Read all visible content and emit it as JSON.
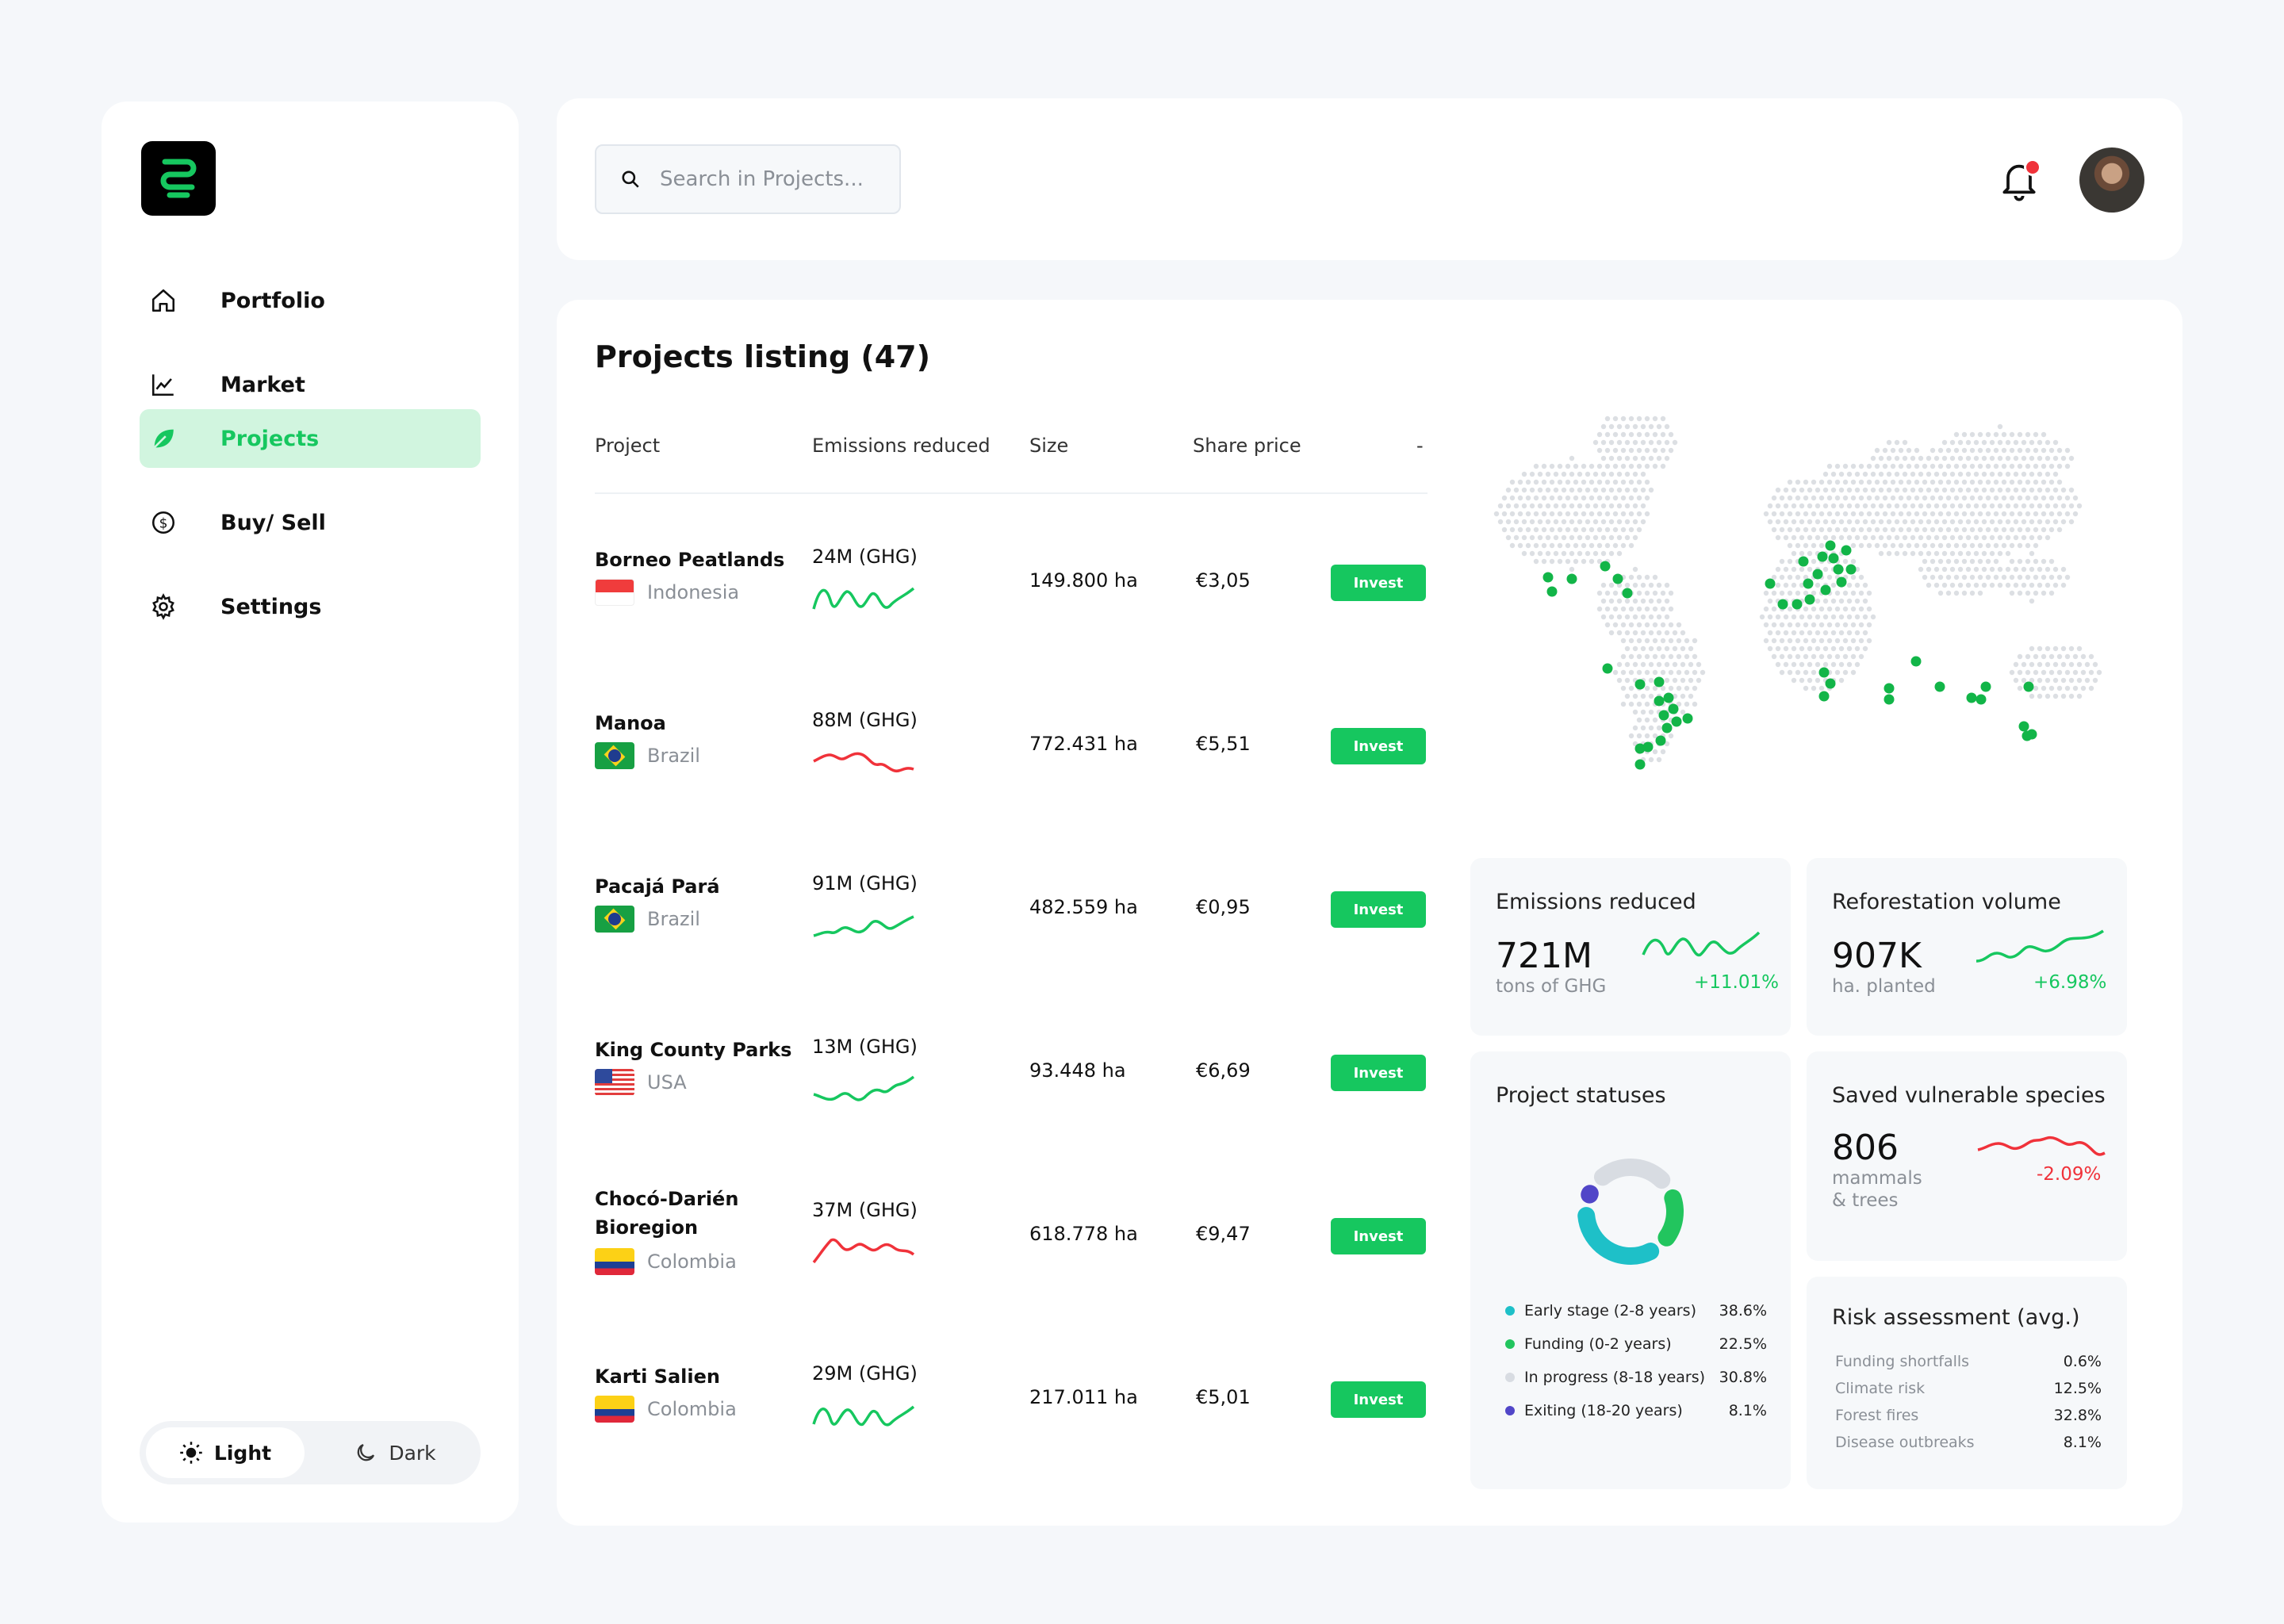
{
  "sidebar": {
    "nav": [
      {
        "label": "Portfolio",
        "icon": "home-icon"
      },
      {
        "label": "Market",
        "icon": "chart-icon"
      },
      {
        "label": "Projects",
        "icon": "leaf-icon",
        "active": true
      },
      {
        "label": "Buy/ Sell",
        "icon": "dollar-icon"
      },
      {
        "label": "Settings",
        "icon": "gear-icon"
      }
    ],
    "theme": {
      "light": "Light",
      "dark": "Dark",
      "selected": "Light"
    }
  },
  "topbar": {
    "search_placeholder": "Search in Projects...",
    "has_notification": true
  },
  "projects": {
    "title": "Projects listing (47)",
    "columns": [
      "Project",
      "Emissions reduced",
      "Size",
      "Share price",
      "-"
    ],
    "rows": [
      {
        "name": "Borneo Peatlands",
        "country": "Indonesia",
        "emissions": "24M (GHG)",
        "size": "149.800 ha",
        "price": "€3,05",
        "action": "Invest",
        "trend": "up"
      },
      {
        "name": "Manoa",
        "country": "Brazil",
        "emissions": "88M (GHG)",
        "size": "772.431 ha",
        "price": "€5,51",
        "action": "Invest",
        "trend": "down"
      },
      {
        "name": "Pacajá Pará",
        "country": "Brazil",
        "emissions": "91M (GHG)",
        "size": "482.559 ha",
        "price": "€0,95",
        "action": "Invest",
        "trend": "up"
      },
      {
        "name": "King County Parks",
        "country": "USA",
        "emissions": "13M (GHG)",
        "size": "93.448 ha",
        "price": "€6,69",
        "action": "Invest",
        "trend": "up"
      },
      {
        "name": "Chocó-Darién Bioregion",
        "country": "Colombia",
        "emissions": "37M (GHG)",
        "size": "618.778 ha",
        "price": "€9,47",
        "action": "Invest",
        "trend": "down"
      },
      {
        "name": "Karti Salien",
        "country": "Colombia",
        "emissions": "29M (GHG)",
        "size": "217.011 ha",
        "price": "€5,01",
        "action": "Invest",
        "trend": "up"
      }
    ]
  },
  "stats": {
    "emissions": {
      "title": "Emissions reduced",
      "value": "721M",
      "unit": "tons of GHG",
      "change": "+11.01%"
    },
    "reforestation": {
      "title": "Reforestation volume",
      "value": "907K",
      "unit": "ha. planted",
      "change": "+6.98%"
    },
    "species": {
      "title": "Saved vulnerable species",
      "value": "806",
      "unit1": "mammals",
      "unit2": "& trees",
      "change": "-2.09%"
    },
    "statuses": {
      "title": "Project statuses",
      "items": [
        {
          "label": "Early stage (2-8 years)",
          "value": "38.6%",
          "share": 38.6,
          "color": "#1ec0c8"
        },
        {
          "label": "Funding (0-2 years)",
          "value": "22.5%",
          "share": 22.5,
          "color": "#22c55e"
        },
        {
          "label": "In progress (8-18 years)",
          "value": "30.8%",
          "share": 30.8,
          "color": "#d8dce2"
        },
        {
          "label": "Exiting (18-20 years)",
          "value": "8.1%",
          "share": 8.1,
          "color": "#5146c8"
        }
      ]
    },
    "risk": {
      "title": "Risk assessment (avg.)",
      "items": [
        {
          "label": "Funding shortfalls",
          "value": "0.6%"
        },
        {
          "label": "Climate risk",
          "value": "12.5%"
        },
        {
          "label": "Forest fires",
          "value": "32.8%"
        },
        {
          "label": "Disease outbreaks",
          "value": "8.1%"
        }
      ]
    }
  },
  "colors": {
    "accent": "#16c75f",
    "negative": "#f0323a",
    "background": "#f5f7fa"
  }
}
